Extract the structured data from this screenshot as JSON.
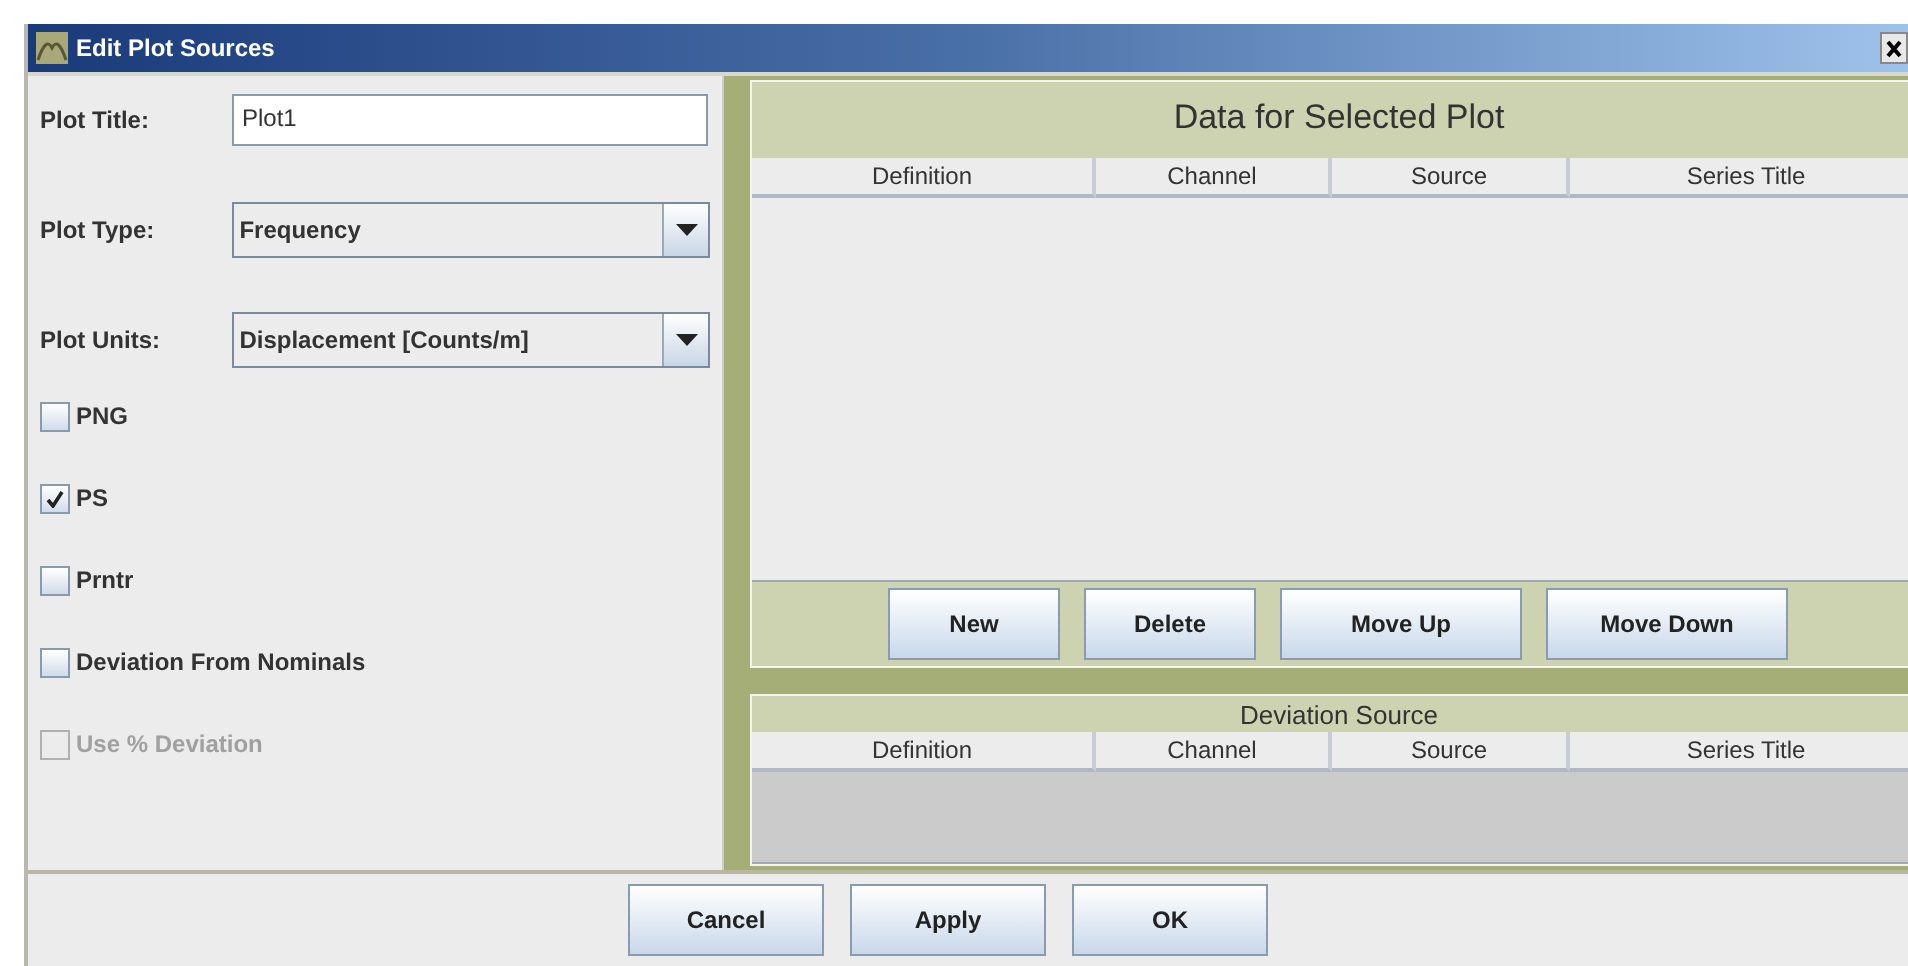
{
  "window": {
    "title": "Edit Plot Sources"
  },
  "form": {
    "plot_title": {
      "label": "Plot Title:",
      "value": "Plot1"
    },
    "plot_type": {
      "label": "Plot Type:",
      "value": "Frequency"
    },
    "plot_units": {
      "label": "Plot Units:",
      "value": "Displacement [Counts/m]"
    }
  },
  "options": [
    {
      "label": "PNG",
      "checked": false,
      "disabled": false
    },
    {
      "label": "PS",
      "checked": true,
      "disabled": false
    },
    {
      "label": "Prntr",
      "checked": false,
      "disabled": false
    },
    {
      "label": "Deviation From Nominals",
      "checked": false,
      "disabled": false
    },
    {
      "label": "Use % Deviation",
      "checked": false,
      "disabled": true
    }
  ],
  "data_panel": {
    "title": "Data for Selected Plot",
    "columns": [
      "Definition",
      "Channel",
      "Source",
      "Series Title"
    ],
    "buttons": [
      "New",
      "Delete",
      "Move Up",
      "Move Down"
    ]
  },
  "deviation_panel": {
    "title": "Deviation Source",
    "columns": [
      "Definition",
      "Channel",
      "Source",
      "Series Title"
    ]
  },
  "buttons": [
    "Cancel",
    "Apply",
    "OK"
  ]
}
